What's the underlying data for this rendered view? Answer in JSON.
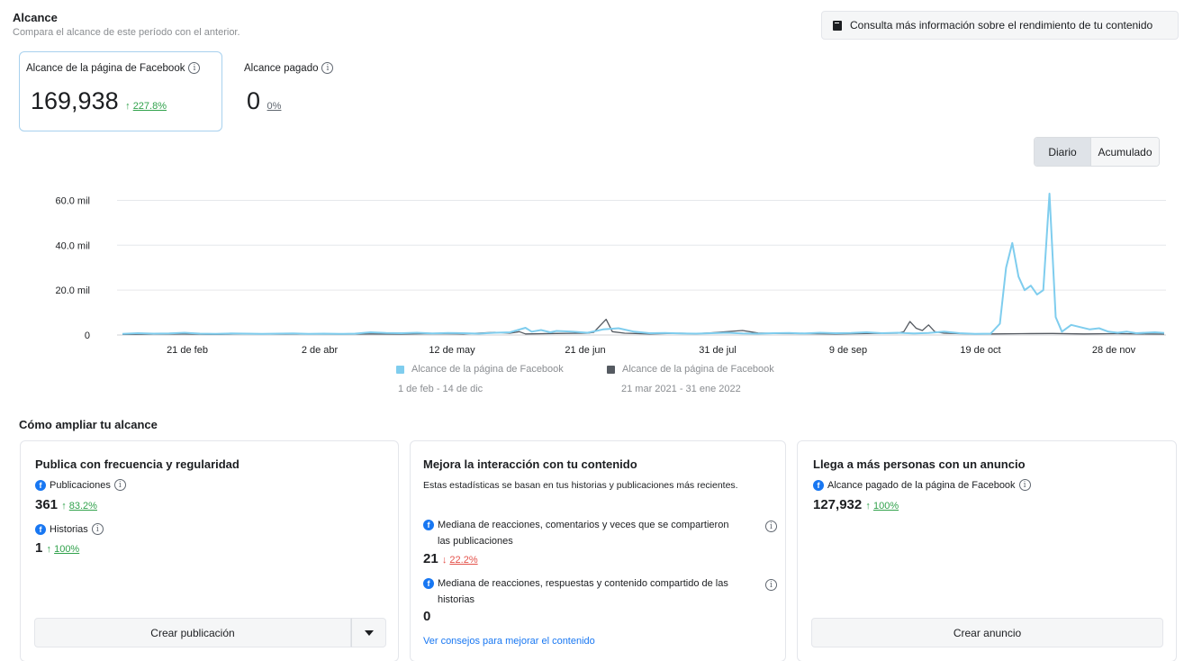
{
  "header": {
    "title": "Alcance",
    "subtitle": "Compara el alcance de este período con el anterior.",
    "info_button": "Consulta más información sobre el rendimiento de tu contenido"
  },
  "metrics": {
    "page_reach": {
      "label": "Alcance de la página de Facebook",
      "value": "169,938",
      "arrow": "↑",
      "change": "227.8%"
    },
    "paid_reach": {
      "label": "Alcance pagado",
      "value": "0",
      "change": "0%"
    }
  },
  "toggle": {
    "daily": "Diario",
    "cumulative": "Acumulado",
    "selected": "Diario"
  },
  "chart_data": {
    "type": "line",
    "y_ticks": [
      "60.0 mil",
      "40.0 mil",
      "20.0 mil",
      "0"
    ],
    "ylim": [
      0,
      65000
    ],
    "x_ticks": [
      "21 de feb",
      "2 de abr",
      "12 de may",
      "21 de jun",
      "31 de jul",
      "9 de sep",
      "19 de oct",
      "28 de nov"
    ],
    "grid": true,
    "series": [
      {
        "name": "Alcance de la página de Facebook",
        "range": "1 de feb - 14 de dic",
        "color": "#7fcdee",
        "points": [
          [
            0,
            500
          ],
          [
            5,
            800
          ],
          [
            10,
            600
          ],
          [
            15,
            700
          ],
          [
            20,
            1000
          ],
          [
            25,
            600
          ],
          [
            30,
            500
          ],
          [
            35,
            700
          ],
          [
            40,
            600
          ],
          [
            45,
            500
          ],
          [
            50,
            600
          ],
          [
            55,
            700
          ],
          [
            60,
            500
          ],
          [
            65,
            600
          ],
          [
            70,
            500
          ],
          [
            75,
            600
          ],
          [
            80,
            1200
          ],
          [
            85,
            900
          ],
          [
            90,
            800
          ],
          [
            95,
            1000
          ],
          [
            100,
            700
          ],
          [
            105,
            900
          ],
          [
            110,
            800
          ],
          [
            115,
            600
          ],
          [
            120,
            1000
          ],
          [
            125,
            1200
          ],
          [
            130,
            3200
          ],
          [
            132,
            1500
          ],
          [
            135,
            2200
          ],
          [
            138,
            1200
          ],
          [
            140,
            1800
          ],
          [
            145,
            1500
          ],
          [
            150,
            1000
          ],
          [
            155,
            2500
          ],
          [
            160,
            3000
          ],
          [
            165,
            1500
          ],
          [
            170,
            800
          ],
          [
            175,
            900
          ],
          [
            180,
            700
          ],
          [
            185,
            600
          ],
          [
            190,
            800
          ],
          [
            195,
            1000
          ],
          [
            200,
            700
          ],
          [
            205,
            600
          ],
          [
            210,
            800
          ],
          [
            215,
            900
          ],
          [
            220,
            700
          ],
          [
            225,
            1000
          ],
          [
            230,
            800
          ],
          [
            235,
            900
          ],
          [
            240,
            1200
          ],
          [
            245,
            800
          ],
          [
            250,
            1000
          ],
          [
            255,
            700
          ],
          [
            260,
            900
          ],
          [
            265,
            1500
          ],
          [
            270,
            800
          ],
          [
            275,
            500
          ],
          [
            280,
            600
          ],
          [
            283,
            5000
          ],
          [
            285,
            30000
          ],
          [
            287,
            41000
          ],
          [
            289,
            26000
          ],
          [
            291,
            20000
          ],
          [
            293,
            22000
          ],
          [
            295,
            18000
          ],
          [
            297,
            20000
          ],
          [
            299,
            63000
          ],
          [
            301,
            8000
          ],
          [
            303,
            1500
          ],
          [
            306,
            4500
          ],
          [
            309,
            3500
          ],
          [
            312,
            2500
          ],
          [
            315,
            3000
          ],
          [
            318,
            1500
          ],
          [
            321,
            1000
          ],
          [
            324,
            1500
          ],
          [
            327,
            800
          ],
          [
            330,
            1000
          ],
          [
            333,
            1200
          ],
          [
            336,
            900
          ]
        ]
      },
      {
        "name": "Alcance de la página de Facebook",
        "range": "21 mar 2021 - 31 ene 2022",
        "color": "#555a61",
        "points": [
          [
            0,
            300
          ],
          [
            10,
            400
          ],
          [
            20,
            500
          ],
          [
            30,
            300
          ],
          [
            40,
            600
          ],
          [
            50,
            400
          ],
          [
            60,
            500
          ],
          [
            70,
            400
          ],
          [
            80,
            500
          ],
          [
            90,
            400
          ],
          [
            100,
            600
          ],
          [
            110,
            500
          ],
          [
            120,
            1200
          ],
          [
            125,
            800
          ],
          [
            128,
            1500
          ],
          [
            130,
            500
          ],
          [
            140,
            700
          ],
          [
            150,
            800
          ],
          [
            152,
            1200
          ],
          [
            156,
            7000
          ],
          [
            158,
            1500
          ],
          [
            162,
            800
          ],
          [
            170,
            500
          ],
          [
            180,
            800
          ],
          [
            185,
            600
          ],
          [
            190,
            1000
          ],
          [
            200,
            2000
          ],
          [
            205,
            900
          ],
          [
            210,
            700
          ],
          [
            220,
            600
          ],
          [
            230,
            500
          ],
          [
            240,
            700
          ],
          [
            250,
            800
          ],
          [
            252,
            1500
          ],
          [
            254,
            6000
          ],
          [
            256,
            3000
          ],
          [
            258,
            2000
          ],
          [
            260,
            4500
          ],
          [
            262,
            1500
          ],
          [
            265,
            800
          ],
          [
            270,
            600
          ],
          [
            280,
            500
          ],
          [
            290,
            600
          ],
          [
            300,
            700
          ],
          [
            310,
            500
          ],
          [
            320,
            600
          ],
          [
            330,
            500
          ],
          [
            336,
            400
          ]
        ]
      }
    ]
  },
  "legend": [
    {
      "name": "Alcance de la página de Facebook",
      "range": "1 de feb - 14 de dic"
    },
    {
      "name": "Alcance de la página de Facebook",
      "range": "21 mar 2021 - 31 ene 2022"
    }
  ],
  "section_title": "Cómo ampliar tu alcance",
  "cards": {
    "publish": {
      "title": "Publica con frecuencia y regularidad",
      "posts_label": "Publicaciones",
      "posts_value": "361",
      "posts_arrow": "↑",
      "posts_change": "83.2%",
      "stories_label": "Historias",
      "stories_value": "1",
      "stories_arrow": "↑",
      "stories_change": "100%",
      "button": "Crear publicación"
    },
    "engagement": {
      "title": "Mejora la interacción con tu contenido",
      "description": "Estas estadísticas se basan en tus historias y publicaciones más recientes.",
      "posts_label": "Mediana de reacciones, comentarios y veces que se compartieron las publicaciones",
      "posts_value": "21",
      "posts_arrow": "↓",
      "posts_change": "22.2%",
      "stories_label": "Mediana de reacciones, respuestas y contenido compartido de las historias",
      "stories_value": "0",
      "link": "Ver consejos para mejorar el contenido"
    },
    "ads": {
      "title": "Llega a más personas con un anuncio",
      "paid_label": "Alcance pagado de la página de Facebook",
      "paid_value": "127,932",
      "paid_arrow": "↑",
      "paid_change": "100%",
      "button": "Crear anuncio"
    }
  }
}
